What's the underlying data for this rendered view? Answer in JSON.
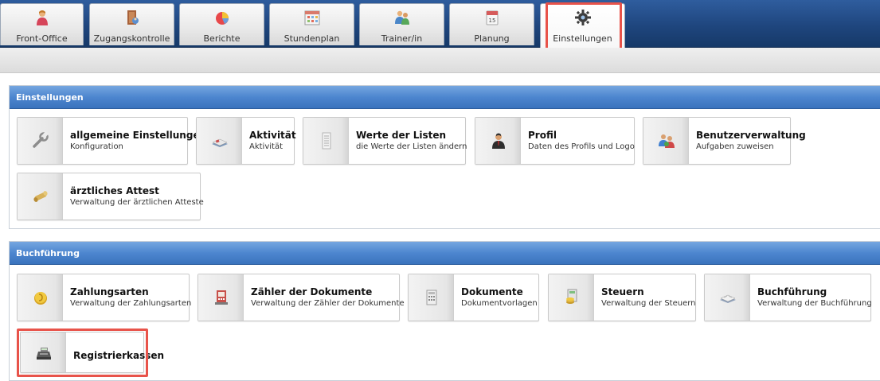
{
  "nav": {
    "tabs": [
      {
        "label": "Front-Office",
        "icon": "person-icon"
      },
      {
        "label": "Zugangskontrolle",
        "icon": "door-icon"
      },
      {
        "label": "Berichte",
        "icon": "pie-chart-icon"
      },
      {
        "label": "Stundenplan",
        "icon": "calendar-grid-icon"
      },
      {
        "label": "Trainer/in",
        "icon": "people-icon"
      },
      {
        "label": "Planung",
        "icon": "calendar-icon"
      },
      {
        "label": "Einstellungen",
        "icon": "gear-icon",
        "active": true
      }
    ],
    "calendar_day": "15"
  },
  "sections": {
    "einstellungen": {
      "header": "Einstellungen",
      "tiles": [
        {
          "title": "allgemeine Einstellungen",
          "subtitle": "Konfiguration",
          "icon": "wrench-icon"
        },
        {
          "title": "Aktivität",
          "subtitle": "Aktivität",
          "icon": "book-icon"
        },
        {
          "title": "Werte der Listen",
          "subtitle": "die Werte der Listen ändern",
          "icon": "list-icon"
        },
        {
          "title": "Profil",
          "subtitle": "Daten des Profils und Logo",
          "icon": "profile-person-icon"
        },
        {
          "title": "Benutzerverwaltung",
          "subtitle": "Aufgaben zuweisen",
          "icon": "users-icon"
        },
        {
          "title": "ärztliches Attest",
          "subtitle": "Verwaltung der ärztlichen Atteste",
          "icon": "scroll-icon"
        }
      ]
    },
    "buchfuehrung": {
      "header": "Buchführung",
      "tiles": [
        {
          "title": "Zahlungsarten",
          "subtitle": "Verwaltung der Zahlungsarten",
          "icon": "coin-icon"
        },
        {
          "title": "Zähler der Dokumente",
          "subtitle": "Verwaltung der Zähler der Dokumente",
          "icon": "document-counter-icon"
        },
        {
          "title": "Dokumente",
          "subtitle": "Dokumentvorlagen",
          "icon": "document-icon"
        },
        {
          "title": "Steuern",
          "subtitle": "Verwaltung der Steuern",
          "icon": "tax-calculator-icon"
        },
        {
          "title": "Buchführung",
          "subtitle": "Verwaltung der Buchführung",
          "icon": "ledger-icon"
        },
        {
          "title": "Registrierkassen",
          "subtitle": "",
          "icon": "cash-register-icon"
        }
      ]
    }
  }
}
